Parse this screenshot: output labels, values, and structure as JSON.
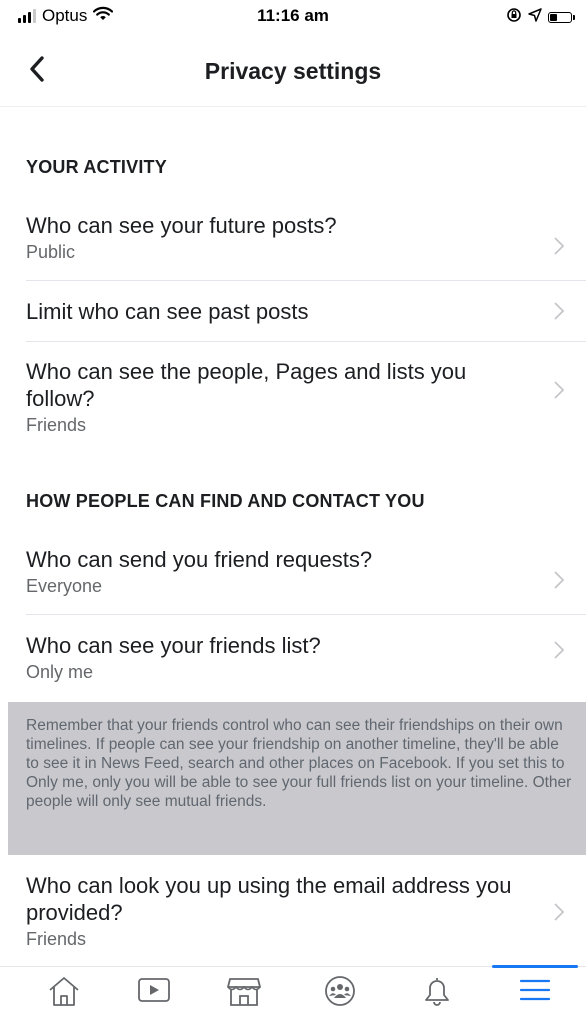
{
  "status_bar": {
    "carrier": "Optus",
    "time": "11:16 am"
  },
  "nav": {
    "title": "Privacy settings",
    "back_icon": "chevron-left-icon"
  },
  "sections": [
    {
      "header": "YOUR ACTIVITY",
      "items": [
        {
          "title": "Who can see your future posts?",
          "subtitle": "Public"
        },
        {
          "title": "Limit who can see past posts",
          "subtitle": ""
        },
        {
          "title": "Who can see the people, Pages and lists you follow?",
          "subtitle": "Friends"
        }
      ]
    },
    {
      "header": "HOW PEOPLE CAN FIND AND CONTACT YOU",
      "items": [
        {
          "title": "Who can send you friend requests?",
          "subtitle": "Everyone"
        },
        {
          "title": "Who can see your friends list?",
          "subtitle": "Only me"
        },
        {
          "title": "Who can look you up using the email address you provided?",
          "subtitle": "Friends"
        }
      ]
    }
  ],
  "friends_list_note": "Remember that your friends control who can see their friendships on their own timelines. If people can see your friendship on another timeline, they'll be able to see it in News Feed, search and other places on Facebook. If you set this to Only me, only you will be able to see your full friends list on your timeline. Other people will only see mutual friends.",
  "tab_bar": {
    "tabs": [
      {
        "icon": "home-icon"
      },
      {
        "icon": "video-icon"
      },
      {
        "icon": "marketplace-icon"
      },
      {
        "icon": "groups-icon"
      },
      {
        "icon": "bell-icon"
      },
      {
        "icon": "menu-icon",
        "active": true
      }
    ],
    "accent_color": "#1877f2"
  },
  "colors": {
    "text": "#1c1e21",
    "secondary_text": "#65676b",
    "note_background": "#c9c9cd"
  }
}
